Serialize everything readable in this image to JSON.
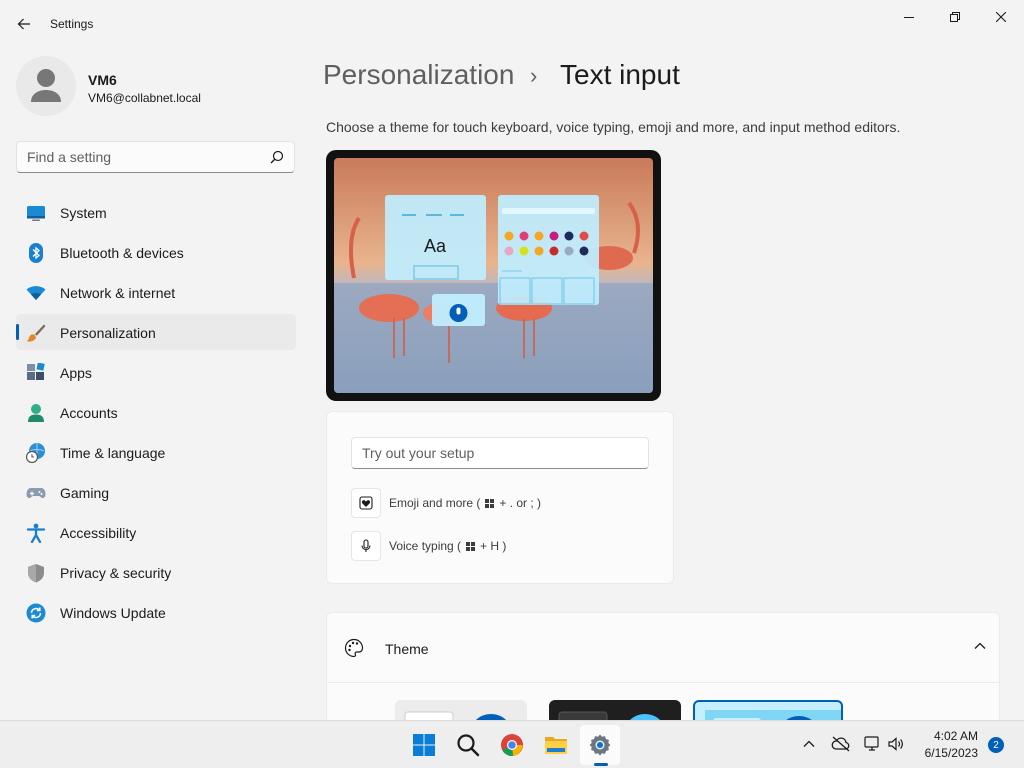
{
  "window": {
    "title": "Settings",
    "back_icon": "arrow-left-icon",
    "controls": [
      "minimize-icon",
      "maximize-icon",
      "close-icon"
    ]
  },
  "user": {
    "name": "VM6",
    "email": "VM6@collabnet.local"
  },
  "search": {
    "placeholder": "Find a setting"
  },
  "nav": {
    "items": [
      {
        "label": "System",
        "icon": "system-icon"
      },
      {
        "label": "Bluetooth & devices",
        "icon": "bluetooth-icon"
      },
      {
        "label": "Network & internet",
        "icon": "wifi-icon"
      },
      {
        "label": "Personalization",
        "icon": "brush-icon",
        "active": true
      },
      {
        "label": "Apps",
        "icon": "apps-icon"
      },
      {
        "label": "Accounts",
        "icon": "person-icon"
      },
      {
        "label": "Time & language",
        "icon": "globe-clock-icon"
      },
      {
        "label": "Gaming",
        "icon": "gamepad-icon"
      },
      {
        "label": "Accessibility",
        "icon": "accessibility-icon"
      },
      {
        "label": "Privacy & security",
        "icon": "shield-icon"
      },
      {
        "label": "Windows Update",
        "icon": "update-icon"
      }
    ]
  },
  "page": {
    "breadcrumb_parent": "Personalization",
    "breadcrumb_separator": "›",
    "breadcrumb_current": "Text input",
    "description": "Choose a theme for touch keyboard, voice typing, emoji and more, and input method editors.",
    "preview_keyboard_text": "Aa"
  },
  "tryout": {
    "placeholder": "Try out your setup",
    "emoji_prefix": "Emoji and more (",
    "emoji_suffix": "+ . or ; )",
    "voice_prefix": "Voice typing (",
    "voice_suffix": "+ H )"
  },
  "theme": {
    "label": "Theme",
    "swatches": [
      "light",
      "dark",
      "light-blue"
    ]
  },
  "taskbar": {
    "pinned": [
      "windows-start-icon",
      "search-icon",
      "chrome-icon",
      "file-explorer-icon",
      "settings-icon"
    ],
    "active": "settings-icon",
    "tray": [
      "chevron-up-icon",
      "cloud-offline-icon",
      "network-icon",
      "speaker-icon"
    ],
    "time": "4:02 AM",
    "date": "6/15/2023",
    "notification_count": "2"
  },
  "colors": {
    "accent": "#005fb8",
    "background": "#f3f3f3",
    "card": "#fbfbfb"
  }
}
